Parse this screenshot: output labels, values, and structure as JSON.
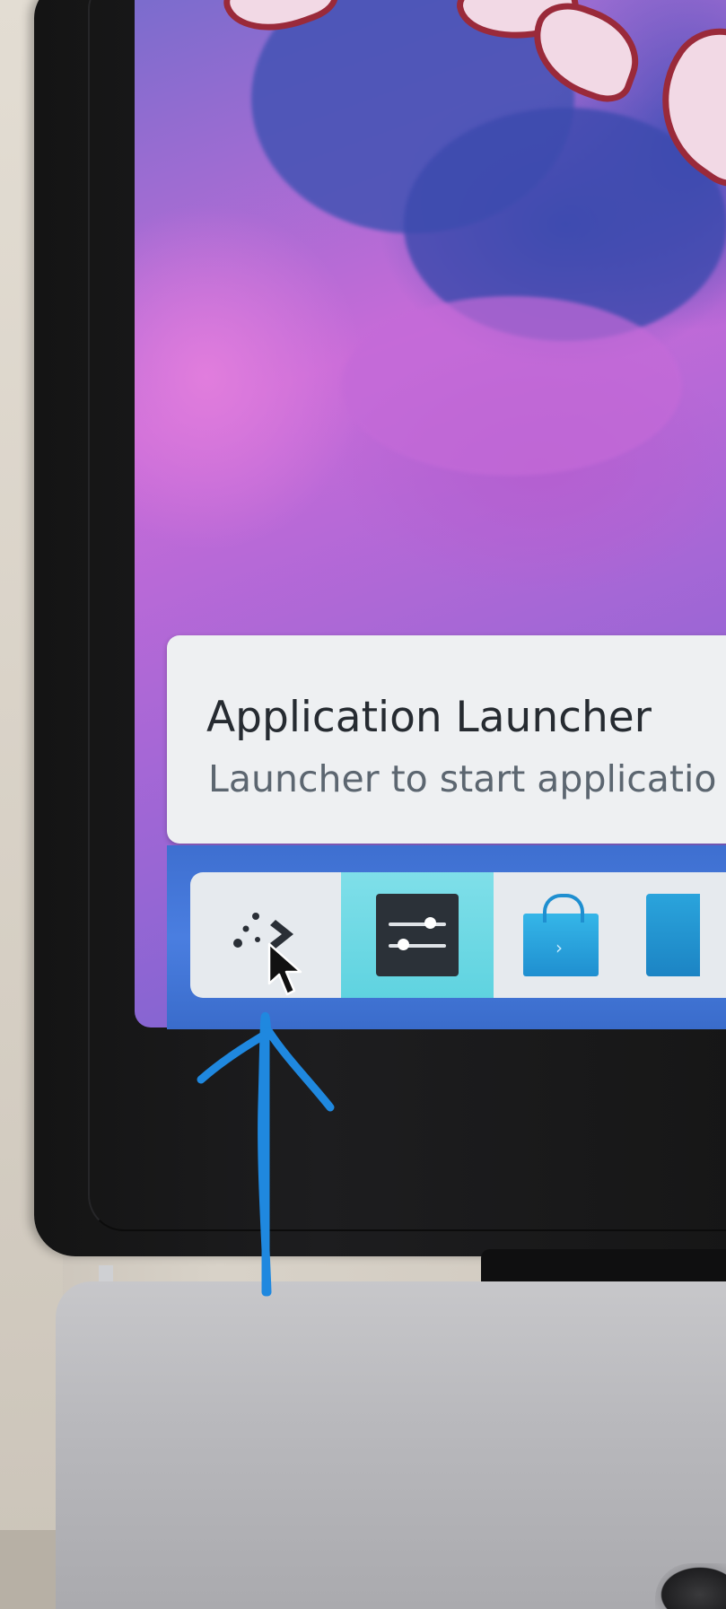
{
  "tooltip": {
    "title": "Application Launcher",
    "subtitle": "Launcher to start applicatio"
  },
  "taskbar": {
    "items": [
      {
        "name": "application-launcher",
        "icon": "kde-launcher-icon",
        "active": false,
        "hovered": true
      },
      {
        "name": "system-settings",
        "icon": "settings-sliders-icon",
        "active": true
      },
      {
        "name": "discover",
        "icon": "shopping-bag-icon",
        "active": false
      },
      {
        "name": "partial-app",
        "icon": "app-icon",
        "active": false
      }
    ]
  },
  "colors": {
    "panel": "#4a7ee0",
    "tooltip_bg": "#eef0f2",
    "active_task": "#6fd9e4",
    "annotation_arrow": "#1f88df",
    "bezel": "#1a1a1c"
  },
  "annotation": {
    "icon": "hand-drawn-arrow-up-icon",
    "color": "#1f88df"
  }
}
